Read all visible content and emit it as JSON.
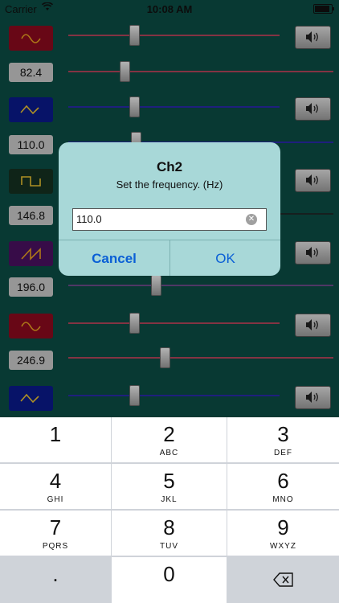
{
  "status_bar": {
    "carrier": "Carrier",
    "time": "10:08 AM"
  },
  "channels": [
    {
      "wave": "sine",
      "wave_color": "#8b0a1e",
      "icon_color": "#e8a020",
      "track_color": "#b0455a"
    },
    {
      "wave": "triangle",
      "wave_color": "#0a1a8b",
      "icon_color": "#e8c030",
      "track_color": "#2a2aa8"
    },
    {
      "wave": "square",
      "wave_color": "#153020",
      "icon_color": "#e8c030",
      "track_color": "#1e2a28"
    },
    {
      "wave": "sawtooth",
      "wave_color": "#4a1060",
      "icon_color": "#e8a020",
      "track_color": "#6a4a88"
    },
    {
      "wave": "sine",
      "wave_color": "#8b0a1e",
      "icon_color": "#e8a020",
      "track_color": "#b0455a"
    },
    {
      "wave": "triangle",
      "wave_color": "#0a1a8b",
      "icon_color": "#e8c030",
      "track_color": "#2a2aa8"
    }
  ],
  "frequencies": [
    "82.4",
    "110.0",
    "146.8",
    "196.0",
    "246.9"
  ],
  "dialog": {
    "title": "Ch2",
    "message": "Set the frequency. (Hz)",
    "input_value": "110.0",
    "cancel_label": "Cancel",
    "ok_label": "OK"
  },
  "keypad": [
    {
      "digit": "1",
      "letters": ""
    },
    {
      "digit": "2",
      "letters": "ABC"
    },
    {
      "digit": "3",
      "letters": "DEF"
    },
    {
      "digit": "4",
      "letters": "GHI"
    },
    {
      "digit": "5",
      "letters": "JKL"
    },
    {
      "digit": "6",
      "letters": "MNO"
    },
    {
      "digit": "7",
      "letters": "PQRS"
    },
    {
      "digit": "8",
      "letters": "TUV"
    },
    {
      "digit": "9",
      "letters": "WXYZ"
    },
    {
      "digit": ".",
      "letters": ""
    },
    {
      "digit": "0",
      "letters": ""
    }
  ]
}
